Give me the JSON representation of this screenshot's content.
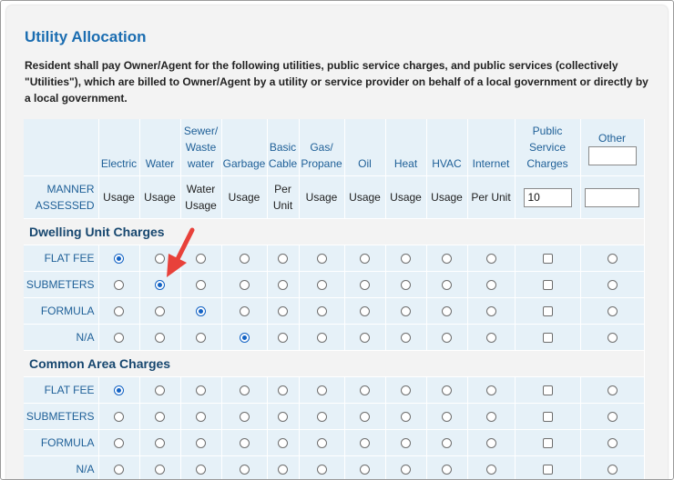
{
  "page": {
    "title": "Utility Allocation",
    "description": "Resident shall pay Owner/Agent for the following utilities, public service charges, and public services (collectively \"Utilities\"), which are billed to Owner/Agent by a utility or service provider on behalf of a local government or directly by a local government."
  },
  "columns": [
    {
      "label": "Electric",
      "manner": "Usage"
    },
    {
      "label": "Water",
      "manner": "Usage"
    },
    {
      "label": "Sewer/\nWaste\nwater",
      "manner": "Water\nUsage"
    },
    {
      "label": "Garbage",
      "manner": "Usage"
    },
    {
      "label": "Basic\nCable",
      "manner": "Per\nUnit"
    },
    {
      "label": "Gas/\nPropane",
      "manner": "Usage"
    },
    {
      "label": "Oil",
      "manner": "Usage"
    },
    {
      "label": "Heat",
      "manner": "Usage"
    },
    {
      "label": "HVAC",
      "manner": "Usage"
    },
    {
      "label": "Internet",
      "manner": "Per Unit"
    },
    {
      "label": "Public\nService\nCharges",
      "manner_value": "10"
    },
    {
      "label": "Other",
      "label_input_value": "",
      "manner_value": ""
    }
  ],
  "manner_label": "MANNER\nASSESSED",
  "sections": [
    {
      "title": "Dwelling Unit Charges",
      "rows": [
        {
          "label": "FLAT FEE",
          "selected": [
            1,
            0,
            0,
            0,
            0,
            0,
            0,
            0,
            0,
            0,
            0,
            0
          ]
        },
        {
          "label": "SUBMETERS",
          "selected": [
            0,
            1,
            0,
            0,
            0,
            0,
            0,
            0,
            0,
            0,
            0,
            0
          ]
        },
        {
          "label": "FORMULA",
          "selected": [
            0,
            0,
            1,
            0,
            0,
            0,
            0,
            0,
            0,
            0,
            0,
            0
          ]
        },
        {
          "label": "N/A",
          "selected": [
            0,
            0,
            0,
            1,
            0,
            0,
            0,
            0,
            0,
            0,
            0,
            0
          ]
        }
      ]
    },
    {
      "title": "Common Area Charges",
      "rows": [
        {
          "label": "FLAT FEE",
          "selected": [
            1,
            0,
            0,
            0,
            0,
            0,
            0,
            0,
            0,
            0,
            0,
            0
          ]
        },
        {
          "label": "SUBMETERS",
          "selected": [
            0,
            0,
            0,
            0,
            0,
            0,
            0,
            0,
            0,
            0,
            0,
            0
          ]
        },
        {
          "label": "FORMULA",
          "selected": [
            0,
            0,
            0,
            0,
            0,
            0,
            0,
            0,
            0,
            0,
            0,
            0
          ]
        },
        {
          "label": "N/A",
          "selected": [
            0,
            0,
            0,
            0,
            0,
            0,
            0,
            0,
            0,
            0,
            0,
            0
          ]
        }
      ]
    }
  ],
  "input_types": [
    "radio",
    "radio",
    "radio",
    "radio",
    "radio",
    "radio",
    "radio",
    "radio",
    "radio",
    "radio",
    "checkbox",
    "radio"
  ],
  "icons": {
    "annotation": "red-arrow-icon"
  },
  "colors": {
    "title": "#1b6db1",
    "label": "#1e5f97",
    "section": "#17476f",
    "cell_bg": "#e6f1f8",
    "panel_bg": "#f3f3f3",
    "radio_checked": "#1262c4",
    "arrow": "#e8413a"
  }
}
